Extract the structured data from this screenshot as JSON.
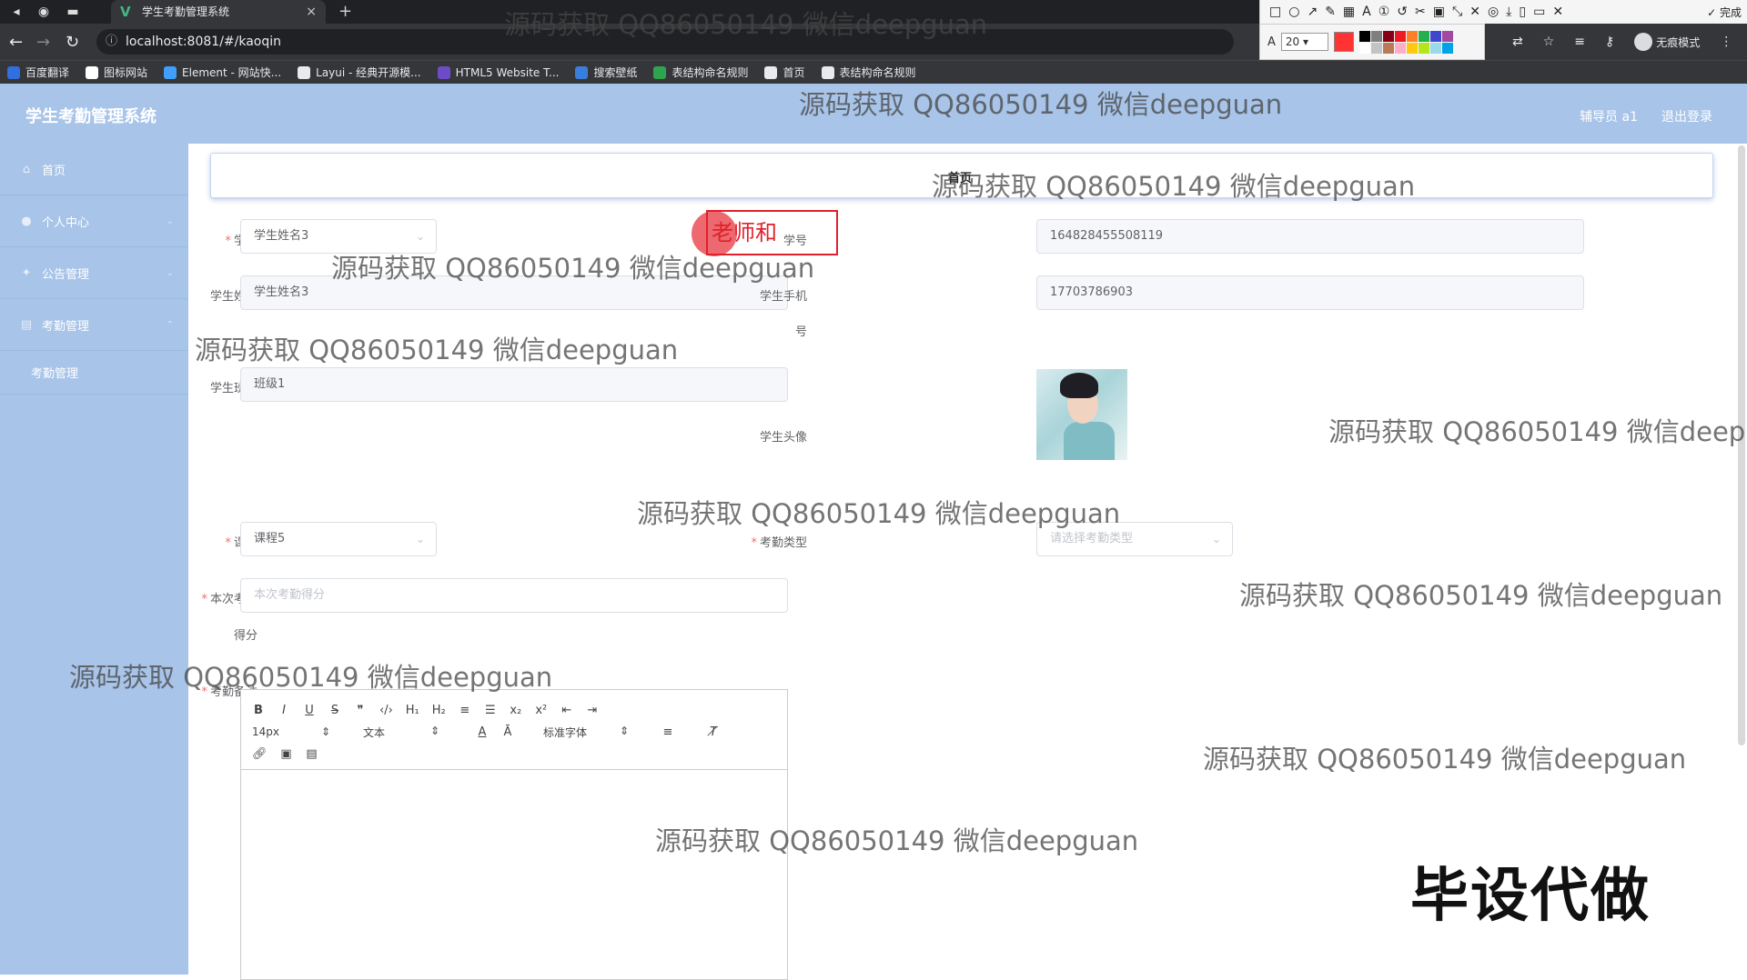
{
  "browser": {
    "tab_title": "学生考勤管理系统",
    "tab_close": "×",
    "new_tab": "+",
    "url": "localhost:8081/#/kaoqin",
    "profile_label": "无痕模式",
    "bookmarks": [
      {
        "label": "百度翻译",
        "color": "#2f6fde"
      },
      {
        "label": "图标网站",
        "color": "#ffffff"
      },
      {
        "label": "Element - 网站快...",
        "color": "#409eff"
      },
      {
        "label": "Layui - 经典开源模...",
        "color": "#e8eaed"
      },
      {
        "label": "HTML5 Website T...",
        "color": "#6f4cc7"
      },
      {
        "label": "搜索壁纸",
        "color": "#3b7ddd"
      },
      {
        "label": "表结构命名规则",
        "color": "#2ea44f"
      },
      {
        "label": "首页",
        "color": "#e8eaed"
      },
      {
        "label": "表结构命名规则",
        "color": "#e8eaed"
      }
    ],
    "annot_font_size": "20",
    "annot_done": "完成",
    "annot_swatches": [
      "#000000",
      "#7f7f7f",
      "#880015",
      "#ed1c24",
      "#ff7f27",
      "#22b14c",
      "#3f48cc",
      "#a349a4",
      "#ffffff",
      "#c3c3c3",
      "#b97a57",
      "#ffaec9",
      "#ffc90e",
      "#b5e61d",
      "#99d9ea",
      "#00a2e8"
    ]
  },
  "app": {
    "title": "学生考勤管理系统",
    "user": "辅导员 a1",
    "logout": "退出登录",
    "sidebar": [
      {
        "label": "首页",
        "icon": "home-icon"
      },
      {
        "label": "个人中心",
        "icon": "user-icon"
      },
      {
        "label": "公告管理",
        "icon": "notice-icon"
      },
      {
        "label": "考勤管理",
        "icon": "attendance-icon"
      }
    ],
    "sidebar_sub": "考勤管理",
    "breadcrumb": "首页"
  },
  "form": {
    "student_label": "学生",
    "student_value": "学生姓名3",
    "student_no_label": "学号",
    "student_no_value": "164828455508119",
    "student_name_label": "学生姓名",
    "student_name_value": "学生姓名3",
    "student_phone_label_1": "学生手机",
    "student_phone_label_2": "号",
    "student_phone_value": "17703786903",
    "student_class_label": "学生班级",
    "student_class_value": "班级1",
    "student_avatar_label": "学生头像",
    "course_label": "课程",
    "course_value": "课程5",
    "attendance_type_label": "考勤类型",
    "attendance_type_placeholder": "请选择考勤类型",
    "score_label_1": "本次考勤",
    "score_label_2": "得分",
    "score_placeholder": "本次考勤得分",
    "remark_label": "考勤备注"
  },
  "editor": {
    "font_size": "14px",
    "text_type": "文本",
    "font_family": "标准字体"
  },
  "overlay": {
    "watermark": "源码获取 QQ86050149 微信deepguan",
    "watermark_cut": "源码获取 QQ86050149 微信deep",
    "annotation_text": "老师和",
    "promo": "毕设代做"
  }
}
